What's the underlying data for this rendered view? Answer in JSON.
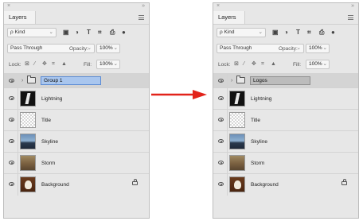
{
  "panels": [
    {
      "id": "left",
      "title": "Layers",
      "kind_label": "Kind",
      "blend_mode": "Pass Through",
      "opacity_label": "Opacity:",
      "opacity_value": "100%",
      "lock_label": "Lock:",
      "fill_label": "Fill:",
      "fill_value": "100%",
      "group_name": "Group 1",
      "group_editing": true,
      "layers": [
        "Lightning",
        "Title",
        "Skyline",
        "Storm",
        "Background"
      ]
    },
    {
      "id": "right",
      "title": "Layers",
      "kind_label": "Kind",
      "blend_mode": "Pass Through",
      "opacity_label": "Opacity:",
      "opacity_value": "100%",
      "lock_label": "Lock:",
      "fill_label": "Fill:",
      "fill_value": "100%",
      "group_name": "Logos",
      "group_editing": false,
      "layers": [
        "Lightning",
        "Title",
        "Skyline",
        "Storm",
        "Background"
      ]
    }
  ],
  "colors": {
    "arrow": "#e2231a",
    "panel_bg": "#e7e7e7",
    "edit_highlight": "#a9c6ee"
  },
  "icons": {
    "close": "close-icon",
    "collapse": "collapse-icon",
    "menu": "panel-menu-icon",
    "search": "search-icon",
    "eye": "eye-icon",
    "folder": "folder-icon",
    "lock": "lock-icon",
    "arrow": "red-right-arrow"
  }
}
